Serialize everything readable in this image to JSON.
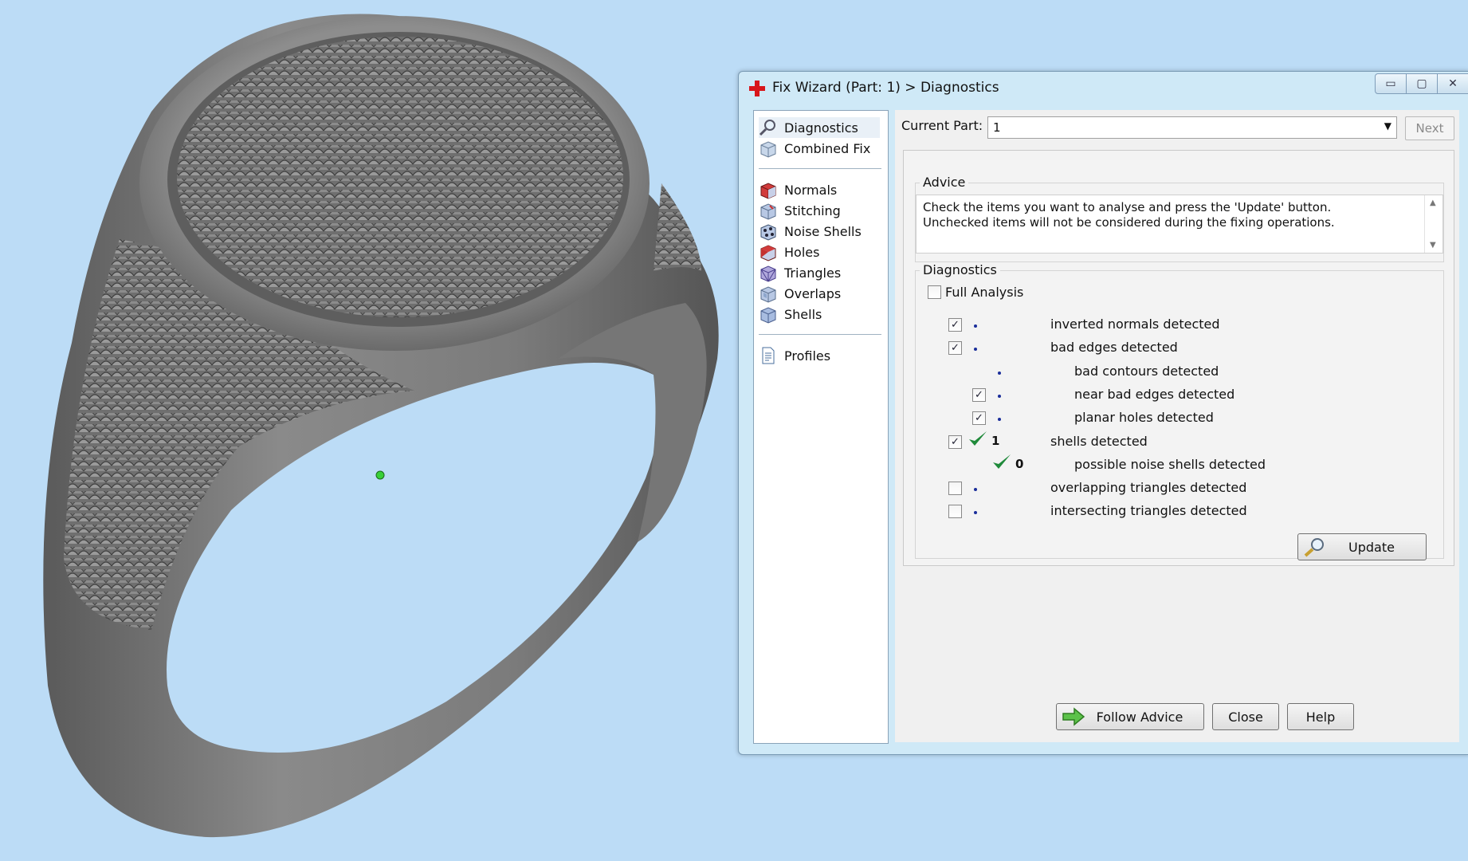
{
  "window": {
    "title": "Fix Wizard (Part: 1) > Diagnostics",
    "min_glyph": "▭",
    "max_glyph": "▢",
    "close_glyph": "✕"
  },
  "nav": {
    "items": [
      {
        "label": "Diagnostics",
        "icon": "magnifier-icon"
      },
      {
        "label": "Combined Fix",
        "icon": "combined-fix-icon"
      },
      {
        "label": "Normals",
        "icon": "normals-cube-icon"
      },
      {
        "label": "Stitching",
        "icon": "stitching-cube-icon"
      },
      {
        "label": "Noise Shells",
        "icon": "noise-shells-icon"
      },
      {
        "label": "Holes",
        "icon": "holes-cube-icon"
      },
      {
        "label": "Triangles",
        "icon": "triangles-cube-icon"
      },
      {
        "label": "Overlaps",
        "icon": "overlaps-cube-icon"
      },
      {
        "label": "Shells",
        "icon": "shells-cube-icon"
      },
      {
        "label": "Profiles",
        "icon": "profiles-document-icon"
      }
    ]
  },
  "current_part": {
    "label": "Current Part:",
    "value": "1",
    "next_label": "Next"
  },
  "advice": {
    "label": "Advice",
    "text": "Check the items you want to analyse and press the 'Update' button. Unchecked items will not be considered during the fixing operations."
  },
  "diagnostics": {
    "label": "Diagnostics",
    "full_analysis_label": "Full Analysis",
    "full_analysis_checked": false,
    "rows": [
      {
        "label": "inverted normals detected",
        "checked": true,
        "status": "dot",
        "count": ""
      },
      {
        "label": "bad edges detected",
        "checked": true,
        "status": "dot",
        "count": ""
      },
      {
        "label": "bad contours detected",
        "checked": null,
        "status": "dot",
        "count": ""
      },
      {
        "label": "near bad edges detected",
        "checked": true,
        "status": "dot",
        "count": ""
      },
      {
        "label": "planar holes detected",
        "checked": true,
        "status": "dot",
        "count": ""
      },
      {
        "label": "shells detected",
        "checked": true,
        "status": "ok",
        "count": "1"
      },
      {
        "label": "possible noise shells detected",
        "checked": null,
        "status": "ok",
        "count": "0"
      },
      {
        "label": "overlapping triangles detected",
        "checked": false,
        "status": "dot",
        "count": ""
      },
      {
        "label": "intersecting triangles detected",
        "checked": false,
        "status": "dot",
        "count": ""
      }
    ],
    "update_label": "Update"
  },
  "footer": {
    "follow_advice_label": "Follow Advice",
    "close_label": "Close",
    "help_label": "Help"
  },
  "colors": {
    "background": "#bcdcf6",
    "window_frame": "#cfe9f7",
    "check_green": "#1f8a3a",
    "bullet_blue": "#1a2d9a"
  }
}
